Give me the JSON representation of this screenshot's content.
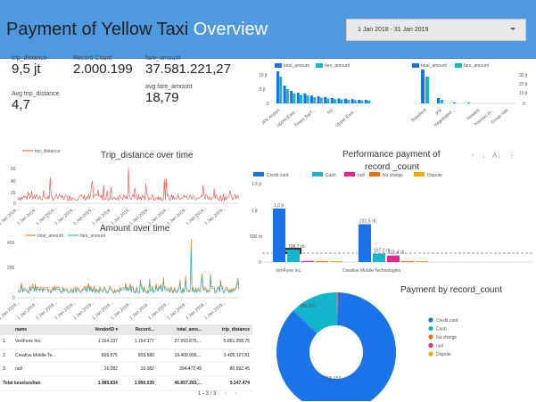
{
  "header": {
    "title_main": "Payment of Yellow Taxi ",
    "title_highlight": "Overview",
    "date_range": "1 Jan 2018 - 31 Jan 2019"
  },
  "scorecards": [
    {
      "label": "trip_distance",
      "value": "9,5 jt"
    },
    {
      "label": "Record Count",
      "value": "2.000.199"
    },
    {
      "label": "fare_amount",
      "value": "37.581.221,27"
    },
    {
      "label": "Avg trip_distance",
      "value": "4,7"
    },
    {
      "label": "avg fare_amount",
      "value": "18,79"
    }
  ],
  "top_bar_1": {
    "legend": [
      "total_amount",
      "fare_amount"
    ],
    "y_ticks": [
      "10 jt",
      "5 jt",
      "0"
    ],
    "categories": [
      "JFK Airport",
      "Upper East...",
      "Times Sq/T...",
      "NV",
      "Upper East..."
    ]
  },
  "top_bar_2": {
    "legend": [
      "total_amount",
      "fare_amount"
    ],
    "y_ticks_right": [
      "30 jt",
      "20 jt",
      "10 jt",
      "0"
    ],
    "categories": [
      "Standard",
      "JFK",
      "Negotiated...",
      "Newark",
      "Nassau or...",
      "Group ride"
    ]
  },
  "trip_chart": {
    "title": "Trip_distance over time",
    "legend": "trip_distance",
    "y_ticks": [
      "60",
      "40",
      "20",
      "0"
    ],
    "x_label": "1 Jan 2019..."
  },
  "amount_chart": {
    "title": "Amount over time",
    "legend": [
      "total_amount",
      "fare_amount"
    ],
    "y_ticks": [
      "400",
      "200",
      "0"
    ],
    "x_label": "1 Jan 2019..."
  },
  "performance": {
    "title_line1": "Performance payment of",
    "title_line2": "record _count",
    "legend": [
      "Credit card",
      "Cash",
      "null",
      "No charge",
      "Dispute"
    ],
    "y_ticks": [
      "1,5 jt",
      "1 jt",
      "500 rb",
      "0"
    ],
    "data_labels": [
      "1,0 jt",
      "708,7 rb",
      "231,5 rb",
      "157,2 rb",
      "121,4 rb"
    ],
    "vendors": [
      "VeriFone Inc.",
      "Creative Mobile Technologies"
    ],
    "reference": "Referensi"
  },
  "donut": {
    "title": "Payment by record_count",
    "legend": [
      "Credit card",
      "Cash",
      "No charge",
      "null",
      "Dispute"
    ],
    "labels": [
      "1.796.153",
      "265.020"
    ]
  },
  "chart_data": [
    {
      "type": "bar",
      "title": "",
      "categories": [
        "VeriFone Inc.",
        "Creative Mobile Technologies"
      ],
      "series": [
        {
          "name": "Credit card",
          "values": [
            1000000,
            708700
          ]
        },
        {
          "name": "Cash",
          "values": [
            231500,
            157200
          ]
        },
        {
          "name": "null",
          "values": [
            20000,
            121400
          ]
        },
        {
          "name": "No charge",
          "values": [
            15000,
            8000
          ]
        },
        {
          "name": "Dispute",
          "values": [
            8000,
            5000
          ]
        }
      ],
      "ylim": [
        0,
        1500000
      ]
    },
    {
      "type": "pie",
      "title": "Payment by record_count",
      "categories": [
        "Credit card",
        "Cash",
        "No charge",
        "null",
        "Dispute"
      ],
      "values": [
        1796153,
        265020,
        5000,
        3000,
        2000
      ]
    }
  ],
  "table": {
    "headers": [
      "name",
      "VendorID",
      "Record...",
      "total_amo...",
      "trip_distance"
    ],
    "sort_icon": "sort-desc-icon",
    "rows": [
      [
        "1.",
        "VeriFone Inc.",
        "1.164.197",
        "1.164.377",
        "27.993.875,...",
        "5.861.358,75"
      ],
      [
        "2.",
        "Creative Mobile Te...",
        "809.575",
        "809.580",
        "18.468.995,...",
        "3.405.127,81"
      ],
      [
        "3.",
        "null",
        "16.082",
        "16.082",
        "394.472,49",
        "80.992,45"
      ]
    ],
    "total": [
      "Total keseluruhan",
      "1.989.834",
      "1.990.039",
      "46.857.283,...",
      "9.347.479"
    ],
    "pager": "1 - 3 / 3"
  },
  "colors": {
    "header_bg": "#4f99df",
    "credit_card": "#1a73e8",
    "cash": "#12b5cb",
    "null": "#e52592",
    "no_charge": "#e8710a",
    "dispute": "#f9ab00",
    "trip_line": "#e8453c"
  }
}
